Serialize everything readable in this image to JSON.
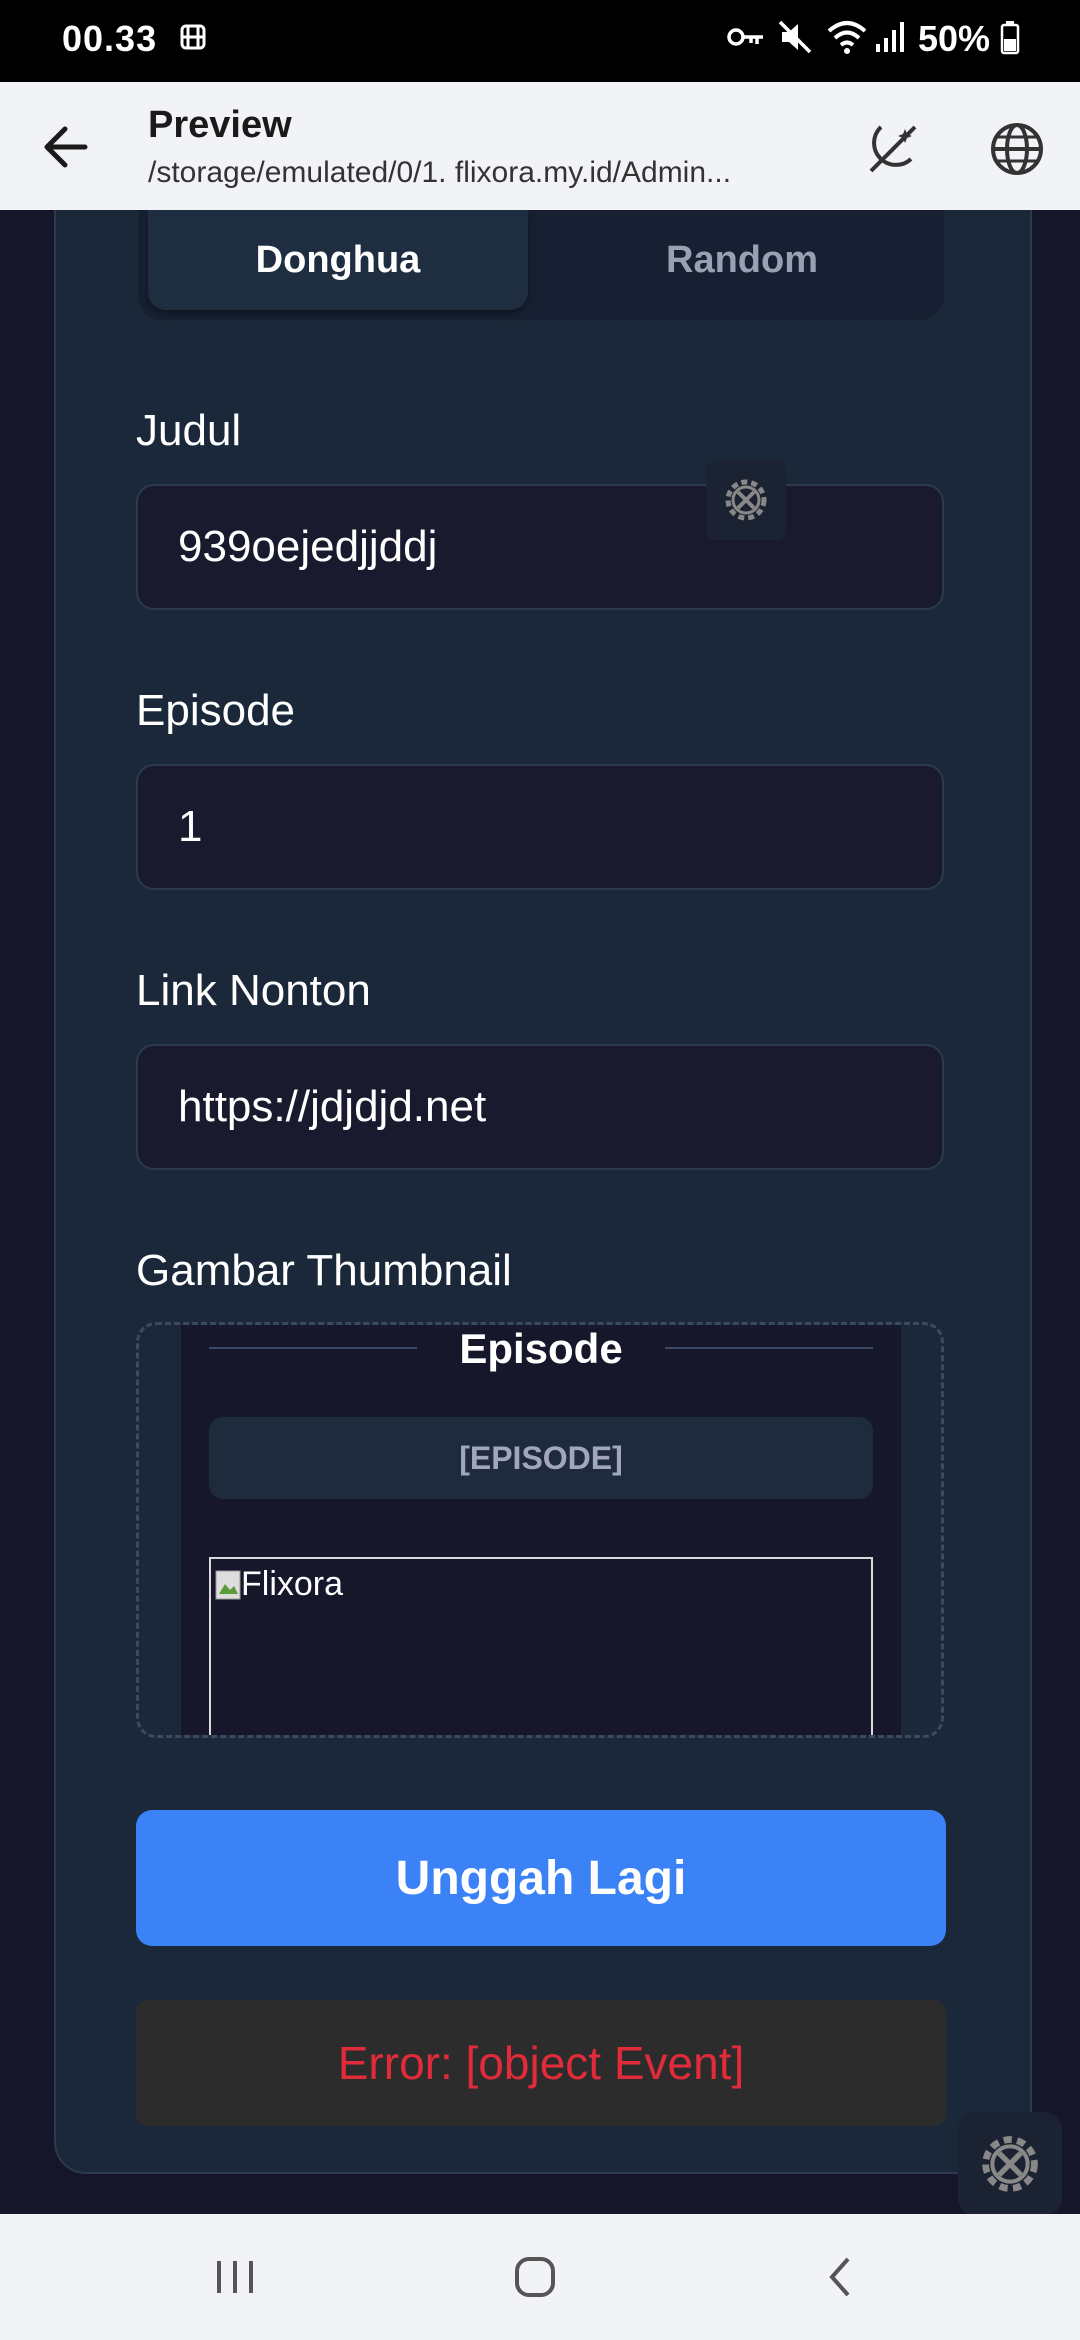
{
  "status_bar": {
    "time": "00.33",
    "battery": "50%"
  },
  "app_bar": {
    "title": "Preview",
    "subtitle": "/storage/emulated/0/1. flixora.my.id/Admin..."
  },
  "tabs": [
    {
      "label": "Donghua",
      "active": true
    },
    {
      "label": "Random",
      "active": false
    }
  ],
  "form": {
    "judul_label": "Judul",
    "judul_value": "939oejedjjddj",
    "episode_label": "Episode",
    "episode_value": "1",
    "link_label": "Link Nonton",
    "link_value": "https://jdjdjd.net",
    "thumbnail_label": "Gambar Thumbnail"
  },
  "thumbnail_preview": {
    "heading": "Episode",
    "badge": "[EPISODE]",
    "image_alt": "Flixora"
  },
  "upload_button": "Unggah Lagi",
  "error_message": "Error: [object Event]",
  "colors": {
    "primary_button": "#3b82f6",
    "error_text": "#e12b3a",
    "card_bg": "#1b2839"
  }
}
